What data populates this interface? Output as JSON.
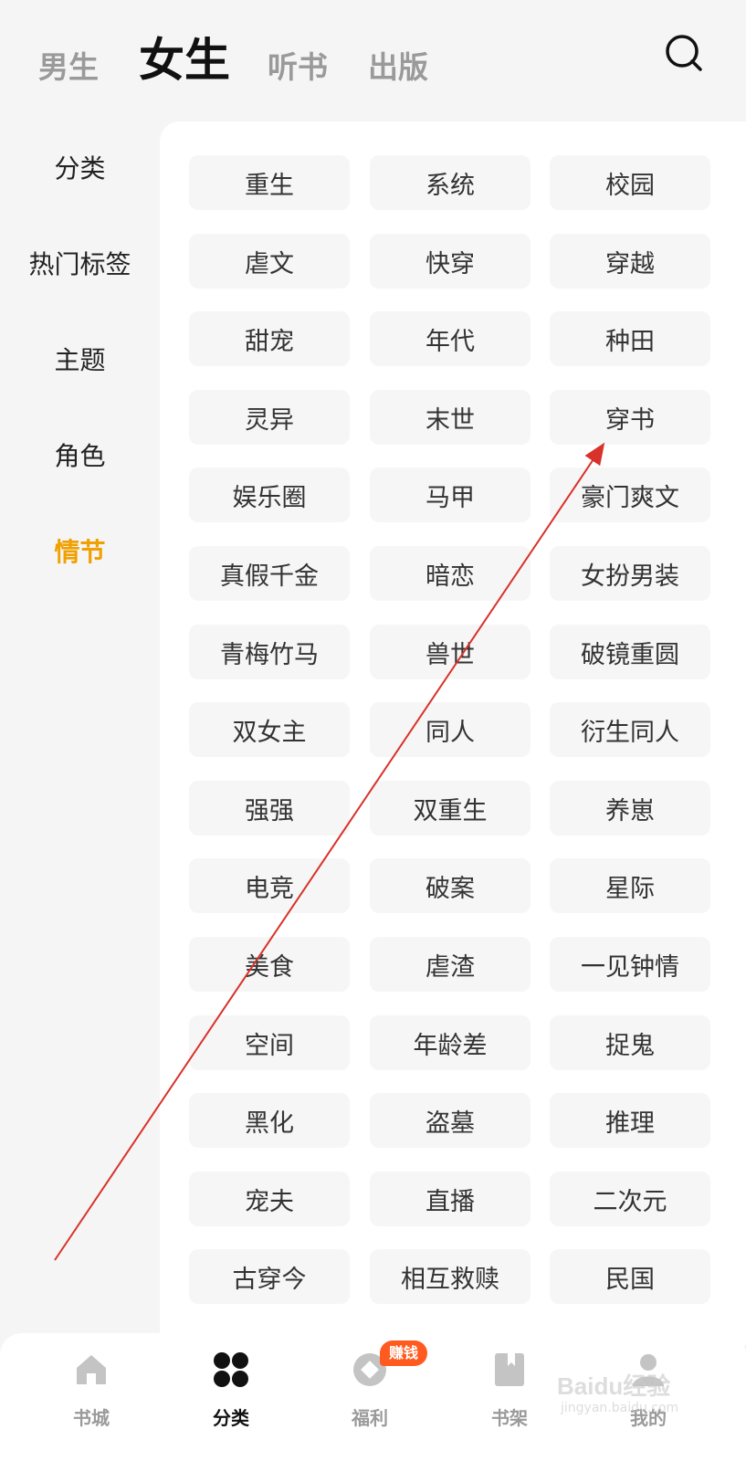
{
  "top_tabs": [
    "男生",
    "女生",
    "听书",
    "出版"
  ],
  "active_top_tab": "女生",
  "side_nav": [
    "分类",
    "热门标签",
    "主题",
    "角色",
    "情节"
  ],
  "active_side": "情节",
  "tags": [
    "重生",
    "系统",
    "校园",
    "虐文",
    "快穿",
    "穿越",
    "甜宠",
    "年代",
    "种田",
    "灵异",
    "末世",
    "穿书",
    "娱乐圈",
    "马甲",
    "豪门爽文",
    "真假千金",
    "暗恋",
    "女扮男装",
    "青梅竹马",
    "兽世",
    "破镜重圆",
    "双女主",
    "同人",
    "衍生同人",
    "强强",
    "双重生",
    "养崽",
    "电竞",
    "破案",
    "星际",
    "美食",
    "虐渣",
    "一见钟情",
    "空间",
    "年龄差",
    "捉鬼",
    "黑化",
    "盗墓",
    "推理",
    "宠夫",
    "直播",
    "二次元",
    "古穿今",
    "相互救赎",
    "民国"
  ],
  "bottom_nav": [
    {
      "label": "书城",
      "icon": "home-icon"
    },
    {
      "label": "分类",
      "icon": "category-icon"
    },
    {
      "label": "福利",
      "icon": "welfare-icon"
    },
    {
      "label": "书架",
      "icon": "bookshelf-icon"
    },
    {
      "label": "我的",
      "icon": "profile-icon"
    }
  ],
  "active_bottom": "分类",
  "badge": "赚钱",
  "watermark": {
    "main": "Baidu经验",
    "sub": "jingyan.baidu.com"
  },
  "colors": {
    "accent": "#f0a000",
    "badge": "#ff5a1f",
    "annotation": "#d8322a"
  }
}
